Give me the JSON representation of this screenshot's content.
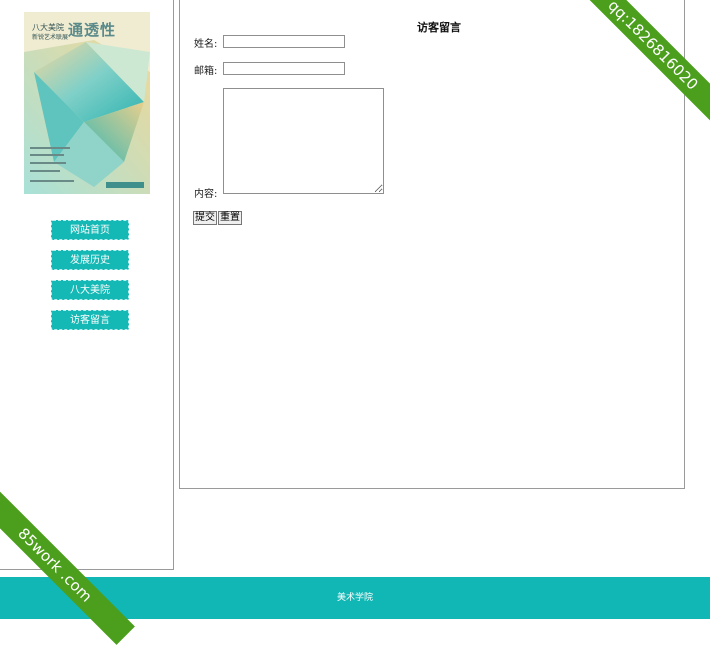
{
  "poster": {
    "title_line1": "八大美院",
    "title_line2": "新锐艺术联展",
    "big_title": "通透性"
  },
  "nav": {
    "items": [
      {
        "label": "网站首页"
      },
      {
        "label": "发展历史"
      },
      {
        "label": "八大美院"
      },
      {
        "label": "访客留言"
      }
    ]
  },
  "form": {
    "title": "访客留言",
    "name_label": "姓名:",
    "email_label": "邮箱:",
    "content_label": "内容:",
    "name_value": "",
    "email_value": "",
    "content_value": "",
    "submit_label": "提交",
    "reset_label": "重置"
  },
  "footer": {
    "text": "美术学院"
  },
  "watermark": {
    "top_right": "qq:1826816020",
    "bottom_left": "85work .com"
  },
  "colors": {
    "accent": "#14b8b5",
    "footer": "#11b7b4",
    "ribbon": "#4c9e1d"
  }
}
